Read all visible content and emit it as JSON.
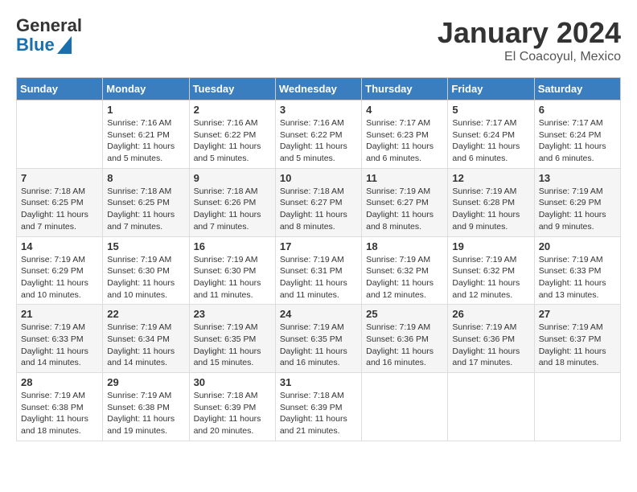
{
  "logo": {
    "general": "General",
    "blue": "Blue"
  },
  "header": {
    "month": "January 2024",
    "location": "El Coacoyul, Mexico"
  },
  "weekdays": [
    "Sunday",
    "Monday",
    "Tuesday",
    "Wednesday",
    "Thursday",
    "Friday",
    "Saturday"
  ],
  "weeks": [
    [
      {
        "day": "",
        "info": ""
      },
      {
        "day": "1",
        "info": "Sunrise: 7:16 AM\nSunset: 6:21 PM\nDaylight: 11 hours\nand 5 minutes."
      },
      {
        "day": "2",
        "info": "Sunrise: 7:16 AM\nSunset: 6:22 PM\nDaylight: 11 hours\nand 5 minutes."
      },
      {
        "day": "3",
        "info": "Sunrise: 7:16 AM\nSunset: 6:22 PM\nDaylight: 11 hours\nand 5 minutes."
      },
      {
        "day": "4",
        "info": "Sunrise: 7:17 AM\nSunset: 6:23 PM\nDaylight: 11 hours\nand 6 minutes."
      },
      {
        "day": "5",
        "info": "Sunrise: 7:17 AM\nSunset: 6:24 PM\nDaylight: 11 hours\nand 6 minutes."
      },
      {
        "day": "6",
        "info": "Sunrise: 7:17 AM\nSunset: 6:24 PM\nDaylight: 11 hours\nand 6 minutes."
      }
    ],
    [
      {
        "day": "7",
        "info": "Sunrise: 7:18 AM\nSunset: 6:25 PM\nDaylight: 11 hours\nand 7 minutes."
      },
      {
        "day": "8",
        "info": "Sunrise: 7:18 AM\nSunset: 6:25 PM\nDaylight: 11 hours\nand 7 minutes."
      },
      {
        "day": "9",
        "info": "Sunrise: 7:18 AM\nSunset: 6:26 PM\nDaylight: 11 hours\nand 7 minutes."
      },
      {
        "day": "10",
        "info": "Sunrise: 7:18 AM\nSunset: 6:27 PM\nDaylight: 11 hours\nand 8 minutes."
      },
      {
        "day": "11",
        "info": "Sunrise: 7:19 AM\nSunset: 6:27 PM\nDaylight: 11 hours\nand 8 minutes."
      },
      {
        "day": "12",
        "info": "Sunrise: 7:19 AM\nSunset: 6:28 PM\nDaylight: 11 hours\nand 9 minutes."
      },
      {
        "day": "13",
        "info": "Sunrise: 7:19 AM\nSunset: 6:29 PM\nDaylight: 11 hours\nand 9 minutes."
      }
    ],
    [
      {
        "day": "14",
        "info": "Sunrise: 7:19 AM\nSunset: 6:29 PM\nDaylight: 11 hours\nand 10 minutes."
      },
      {
        "day": "15",
        "info": "Sunrise: 7:19 AM\nSunset: 6:30 PM\nDaylight: 11 hours\nand 10 minutes."
      },
      {
        "day": "16",
        "info": "Sunrise: 7:19 AM\nSunset: 6:30 PM\nDaylight: 11 hours\nand 11 minutes."
      },
      {
        "day": "17",
        "info": "Sunrise: 7:19 AM\nSunset: 6:31 PM\nDaylight: 11 hours\nand 11 minutes."
      },
      {
        "day": "18",
        "info": "Sunrise: 7:19 AM\nSunset: 6:32 PM\nDaylight: 11 hours\nand 12 minutes."
      },
      {
        "day": "19",
        "info": "Sunrise: 7:19 AM\nSunset: 6:32 PM\nDaylight: 11 hours\nand 12 minutes."
      },
      {
        "day": "20",
        "info": "Sunrise: 7:19 AM\nSunset: 6:33 PM\nDaylight: 11 hours\nand 13 minutes."
      }
    ],
    [
      {
        "day": "21",
        "info": "Sunrise: 7:19 AM\nSunset: 6:33 PM\nDaylight: 11 hours\nand 14 minutes."
      },
      {
        "day": "22",
        "info": "Sunrise: 7:19 AM\nSunset: 6:34 PM\nDaylight: 11 hours\nand 14 minutes."
      },
      {
        "day": "23",
        "info": "Sunrise: 7:19 AM\nSunset: 6:35 PM\nDaylight: 11 hours\nand 15 minutes."
      },
      {
        "day": "24",
        "info": "Sunrise: 7:19 AM\nSunset: 6:35 PM\nDaylight: 11 hours\nand 16 minutes."
      },
      {
        "day": "25",
        "info": "Sunrise: 7:19 AM\nSunset: 6:36 PM\nDaylight: 11 hours\nand 16 minutes."
      },
      {
        "day": "26",
        "info": "Sunrise: 7:19 AM\nSunset: 6:36 PM\nDaylight: 11 hours\nand 17 minutes."
      },
      {
        "day": "27",
        "info": "Sunrise: 7:19 AM\nSunset: 6:37 PM\nDaylight: 11 hours\nand 18 minutes."
      }
    ],
    [
      {
        "day": "28",
        "info": "Sunrise: 7:19 AM\nSunset: 6:38 PM\nDaylight: 11 hours\nand 18 minutes."
      },
      {
        "day": "29",
        "info": "Sunrise: 7:19 AM\nSunset: 6:38 PM\nDaylight: 11 hours\nand 19 minutes."
      },
      {
        "day": "30",
        "info": "Sunrise: 7:18 AM\nSunset: 6:39 PM\nDaylight: 11 hours\nand 20 minutes."
      },
      {
        "day": "31",
        "info": "Sunrise: 7:18 AM\nSunset: 6:39 PM\nDaylight: 11 hours\nand 21 minutes."
      },
      {
        "day": "",
        "info": ""
      },
      {
        "day": "",
        "info": ""
      },
      {
        "day": "",
        "info": ""
      }
    ]
  ]
}
